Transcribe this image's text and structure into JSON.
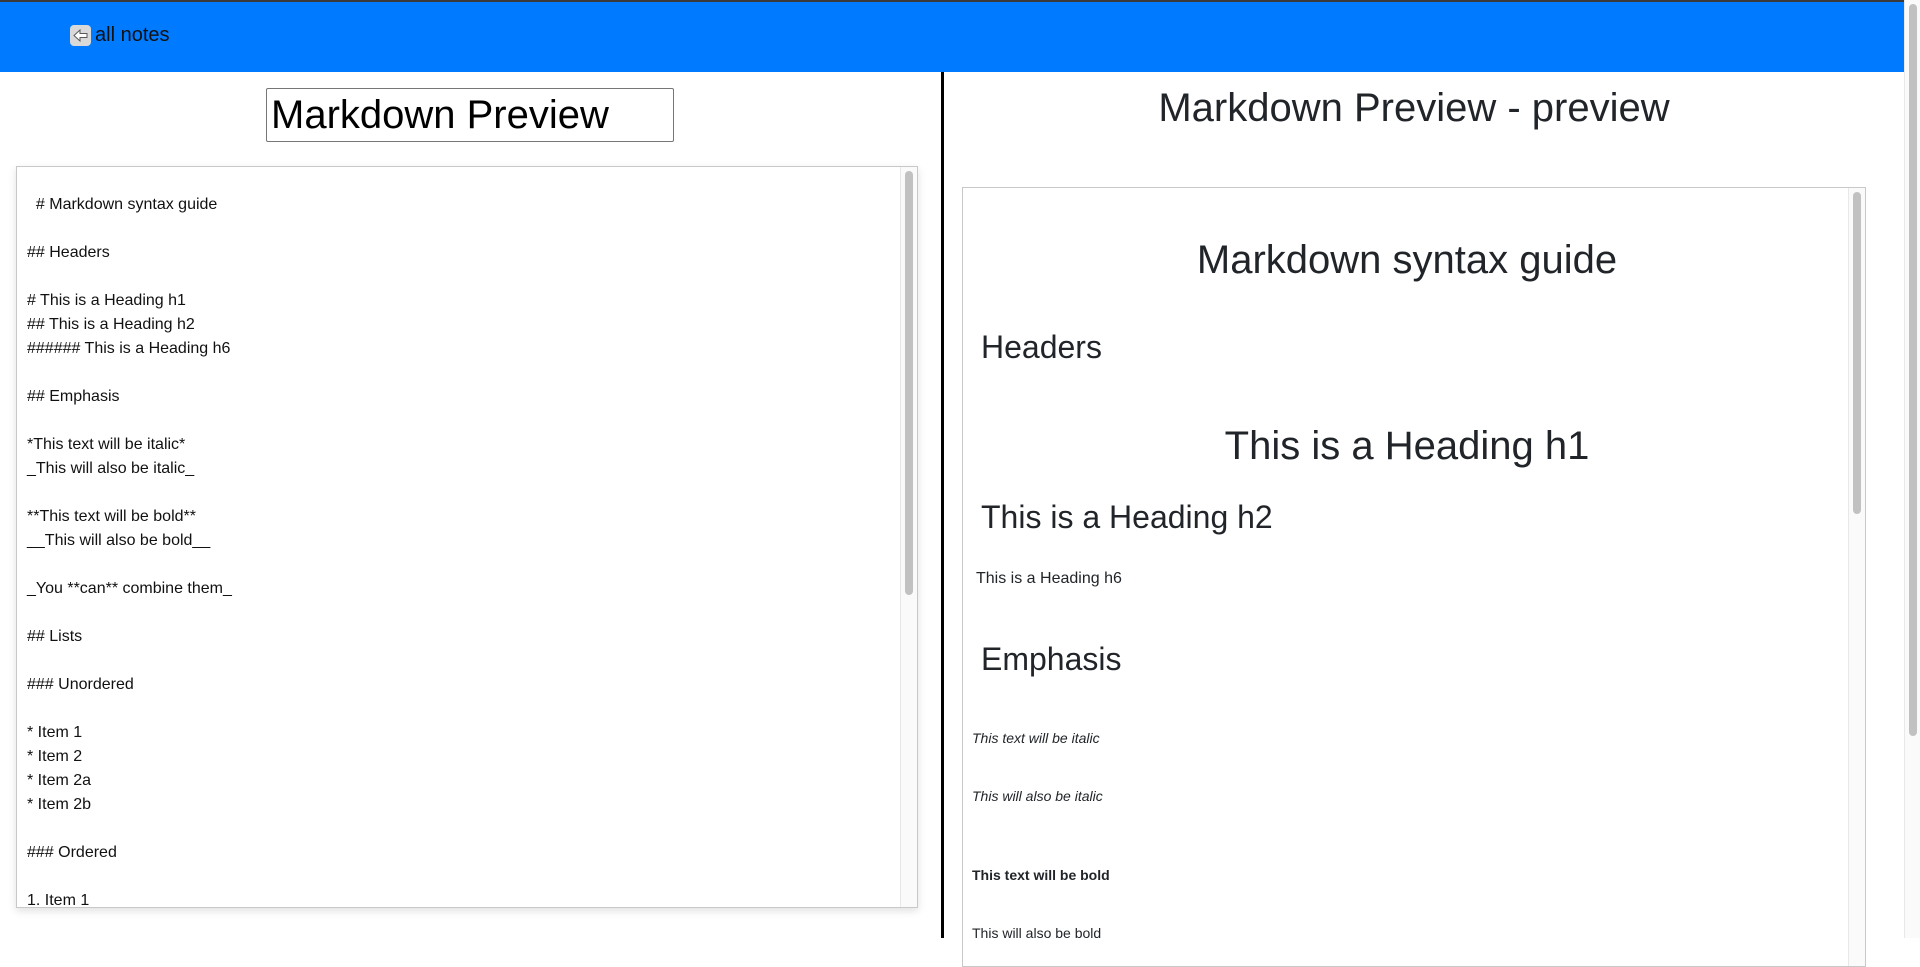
{
  "nav": {
    "back_icon": "back-arrow-icon",
    "back_label": "all notes"
  },
  "editor": {
    "title_value": "Markdown Preview",
    "content": "  # Markdown syntax guide\n\n## Headers\n\n# This is a Heading h1\n## This is a Heading h2\n###### This is a Heading h6\n\n## Emphasis\n\n*This text will be italic*\n_This will also be italic_\n\n**This text will be bold**\n__This will also be bold__\n\n_You **can** combine them_\n\n## Lists\n\n### Unordered\n\n* Item 1\n* Item 2\n* Item 2a\n* Item 2b\n\n### Ordered\n\n1. Item 1"
  },
  "preview": {
    "title": "Markdown Preview - preview",
    "h1_guide": "Markdown syntax guide",
    "h2_headers": "Headers",
    "h1_example": "This is a Heading h1",
    "h2_example": "This is a Heading h2",
    "h6_example": "This is a Heading h6",
    "h2_emphasis": "Emphasis",
    "italic_1": "This text will be italic",
    "italic_2": "This will also be italic",
    "bold_1": "This text will be bold",
    "bold_2": "This will also be bold"
  },
  "colors": {
    "topbar": "#007bff",
    "divider": "#000000"
  }
}
